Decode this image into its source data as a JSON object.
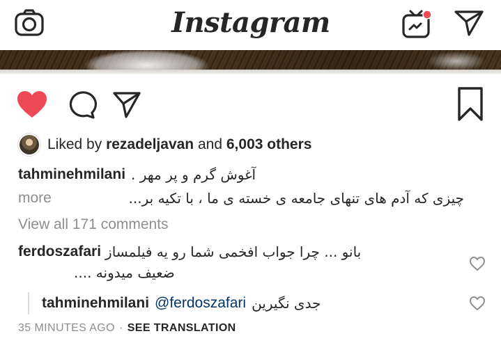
{
  "header": {
    "title": "Instagram",
    "icons": {
      "camera": "camera-icon",
      "igtv": "igtv-icon",
      "direct": "direct-message-icon"
    },
    "igtv_badge_color": "#ed4956"
  },
  "actions": {
    "icons": [
      "heart-icon",
      "comment-icon",
      "share-icon",
      "bookmark-icon"
    ],
    "liked": true,
    "like_color": "#ed4956"
  },
  "likes": {
    "prefix": "Liked by",
    "user": "rezadeljavan",
    "connector": "and",
    "others": "6,003 others"
  },
  "caption": {
    "username": "tahminehmilani",
    "line1": "آغوش گرم و پر مهر .",
    "line2": "چیزی که  آدم های تنهای جامعه ی خسته ی ما ،  با تکیه بر...",
    "more_label": "more"
  },
  "view_all_comments": "View all 171 comments",
  "comments": [
    {
      "username": "ferdoszafari",
      "text_line1": "بانو ... چرا جواب افخمی شما رو یه فیلمساز",
      "text_line2": "ضعیف میدونه ...."
    }
  ],
  "reply": {
    "username": "tahminehmilani",
    "mention": "@ferdoszafari",
    "text": "جدی نگیرین"
  },
  "meta": {
    "time": "35 MINUTES AGO",
    "separator": "·",
    "translate": "SEE TRANSLATION"
  }
}
